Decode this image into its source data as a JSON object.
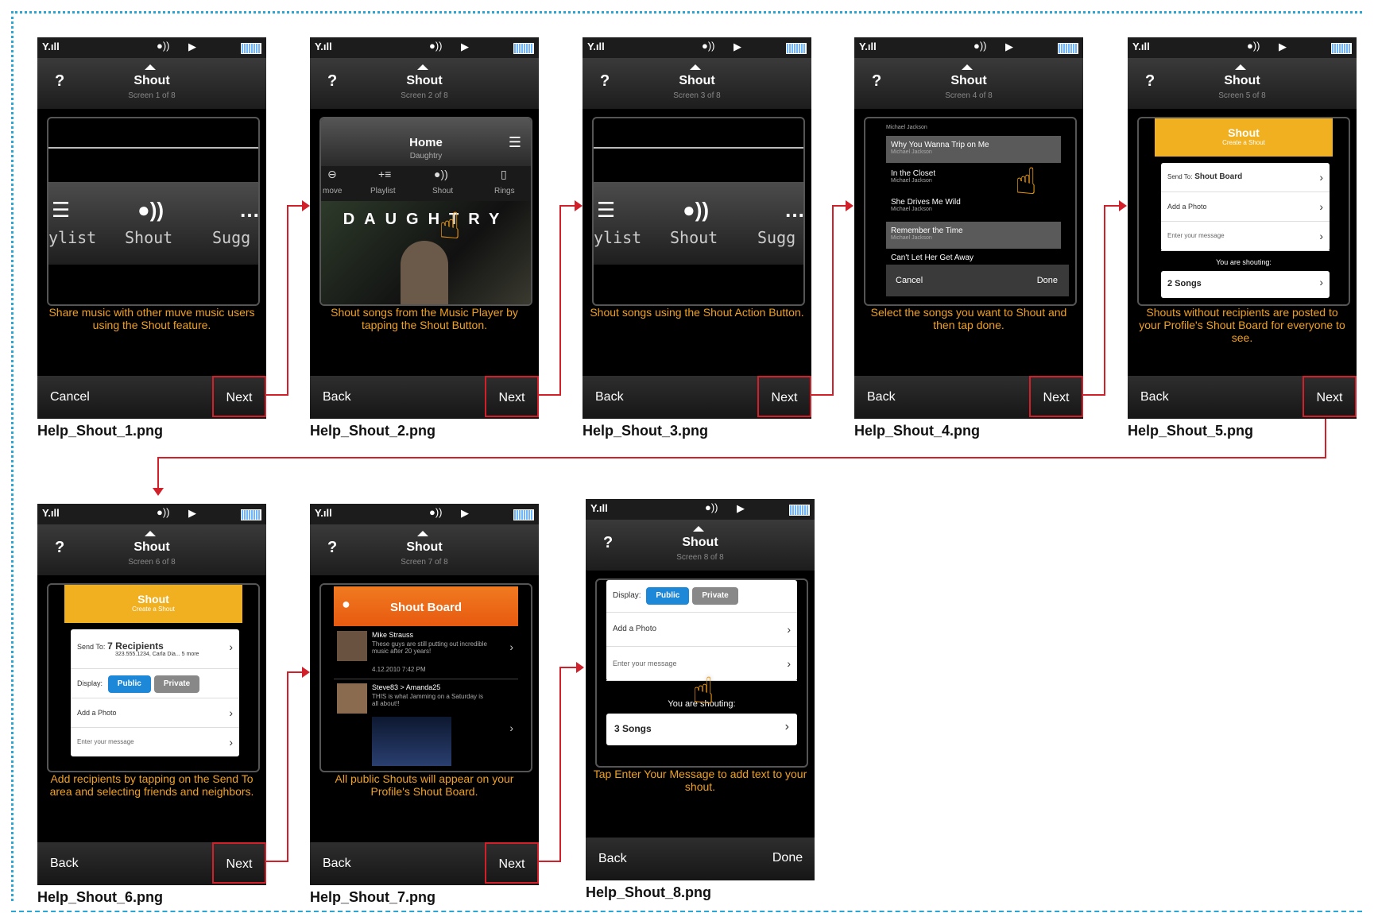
{
  "status": {
    "signal": "Y.ıll",
    "speaker": "●))",
    "play": "▶"
  },
  "common": {
    "help": "?",
    "title": "Shout"
  },
  "screens": [
    {
      "sub": "Screen 1 of 8",
      "caption": "Share music with other muve music users using the Shout feature.",
      "left": "Cancel",
      "right": "Next",
      "file": "Help_Shout_1.png",
      "labels": [
        "ylist",
        "Shout",
        "Sugg"
      ]
    },
    {
      "sub": "Screen 2 of 8",
      "caption": "Shout songs from the Music Player by tapping the Shout Button.",
      "left": "Back",
      "right": "Next",
      "file": "Help_Shout_2.png",
      "home": "Home",
      "artist": "Daughtry",
      "actions": [
        "move",
        "Playlist",
        "Shout",
        "Rings"
      ],
      "band": "DAUGHTRY"
    },
    {
      "sub": "Screen 3 of 8",
      "caption": "Shout songs using the Shout Action Button.",
      "left": "Back",
      "right": "Next",
      "file": "Help_Shout_3.png",
      "labels": [
        "ylist",
        "Shout",
        "Sugg"
      ]
    },
    {
      "sub": "Screen 4 of 8",
      "caption": "Select the songs you want to Shout and then tap done.",
      "left": "Back",
      "right": "Next",
      "file": "Help_Shout_4.png",
      "songs": [
        {
          "t": "Why You Wanna Trip on Me",
          "a": "Michael Jackson"
        },
        {
          "t": "In the Closet",
          "a": "Michael Jackson"
        },
        {
          "t": "She Drives Me Wild",
          "a": "Michael Jackson"
        },
        {
          "t": "Remember the Time",
          "a": "Michael Jackson"
        },
        {
          "t": "Can't Let Her Get Away",
          "a": ""
        }
      ],
      "cancel": "Cancel",
      "done": "Done",
      "top_artist": "Michael Jackson"
    },
    {
      "sub": "Screen 5 of 8",
      "caption": "Shouts without recipients are posted to your Profile's Shout Board for everyone to see.",
      "left": "Back",
      "right": "Next",
      "file": "Help_Shout_5.png",
      "tab": "Shout",
      "tabsub": "Create a Shout",
      "sendto": "Send To:",
      "board": "Shout Board",
      "photo": "Add a Photo",
      "msg": "Enter your message",
      "shouting": "You are shouting:",
      "songs": "2 Songs"
    },
    {
      "sub": "Screen 6 of 8",
      "caption": "Add recipients by tapping on the Send To area and selecting friends and neighbors.",
      "left": "Back",
      "right": "Next",
      "file": "Help_Shout_6.png",
      "tab": "Shout",
      "tabsub": "Create a Shout",
      "sendto": "Send To:",
      "recips": "7 Recipients",
      "recipsub": "323.555.1234, Carla Dia... 5 more",
      "display": "Display:",
      "public": "Public",
      "private": "Private",
      "photo": "Add a Photo",
      "msg": "Enter your message"
    },
    {
      "sub": "Screen 7 of 8",
      "caption": "All public Shouts will appear on your Profile's Shout Board.",
      "left": "Back",
      "right": "Next",
      "file": "Help_Shout_7.png",
      "board": "Shout Board",
      "p1name": "Mike Strauss",
      "p1text": "These guys are still putting out incredible music after 20 years!",
      "p1date": "4.12.2010 7:42 PM",
      "p2name": "Steve83 > Amanda25",
      "p2text": "THIS is what Jamming on a Saturday is all about!!"
    },
    {
      "sub": "Screen 8 of 8",
      "caption": "Tap Enter Your Message to add text to your shout.",
      "left": "Back",
      "right": "Done",
      "file": "Help_Shout_8.png",
      "display": "Display:",
      "public": "Public",
      "private": "Private",
      "photo": "Add a Photo",
      "msg": "Enter your message",
      "shouting": "You are shouting:",
      "songs": "3 Songs"
    }
  ],
  "colors": {
    "accent": "#f0a020",
    "arrow": "#d1202a",
    "border": "#2aa6d6",
    "public": "#1e88d8",
    "private": "#888888"
  }
}
